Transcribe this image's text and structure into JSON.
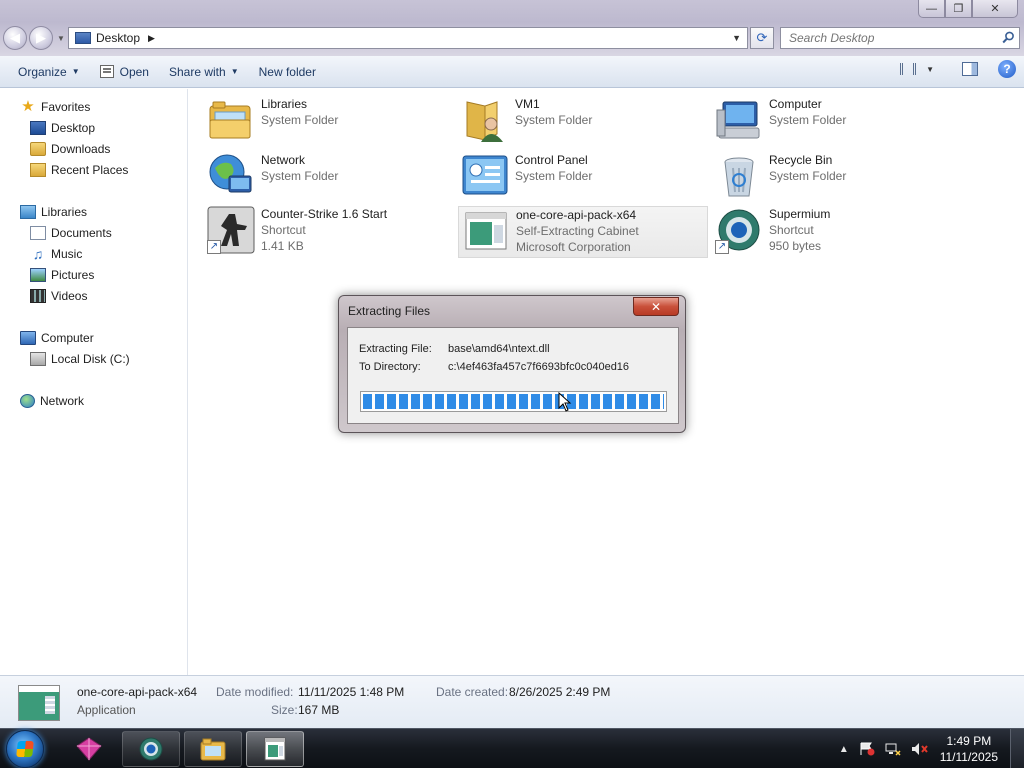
{
  "window": {
    "buttons": {
      "minimize": "—",
      "maximize": "❐",
      "close": "✕"
    }
  },
  "addressbar": {
    "crumb": "Desktop",
    "search_placeholder": "Search Desktop"
  },
  "commandbar": {
    "organize": "Organize",
    "open": "Open",
    "share_with": "Share with",
    "new_folder": "New folder"
  },
  "navpane": {
    "favorites": "Favorites",
    "desktop": "Desktop",
    "downloads": "Downloads",
    "recent_places": "Recent Places",
    "libraries": "Libraries",
    "documents": "Documents",
    "music": "Music",
    "pictures": "Pictures",
    "videos": "Videos",
    "computer": "Computer",
    "local_disk": "Local Disk (C:)",
    "network": "Network"
  },
  "items": [
    {
      "name": "Libraries",
      "line1": "System Folder",
      "line2": "",
      "icon": "libraries-icon"
    },
    {
      "name": "VM1",
      "line1": "System Folder",
      "line2": "",
      "icon": "user-folder-icon"
    },
    {
      "name": "Computer",
      "line1": "System Folder",
      "line2": "",
      "icon": "computer-icon"
    },
    {
      "name": "Network",
      "line1": "System Folder",
      "line2": "",
      "icon": "network-globe-icon"
    },
    {
      "name": "Control Panel",
      "line1": "System Folder",
      "line2": "",
      "icon": "control-panel-icon"
    },
    {
      "name": "Recycle Bin",
      "line1": "System Folder",
      "line2": "",
      "icon": "recycle-bin-icon"
    },
    {
      "name": "Counter-Strike 1.6 Start",
      "line1": "Shortcut",
      "line2": "1.41 KB",
      "icon": "counter-strike-icon"
    },
    {
      "name": "one-core-api-pack-x64",
      "line1": "Self-Extracting Cabinet",
      "line2": "Microsoft Corporation",
      "icon": "cabinet-installer-icon"
    },
    {
      "name": "Supermium",
      "line1": "Shortcut",
      "line2": "950 bytes",
      "icon": "supermium-browser-icon"
    }
  ],
  "dialog": {
    "title": "Extracting Files",
    "close": "✕",
    "file_label": "Extracting File:",
    "file_value": "base\\amd64\\ntext.dll",
    "dir_label": "To Directory:",
    "dir_value": "c:\\4ef463fa457c7f6693bfc0c040ed16",
    "progress": 1.0
  },
  "details": {
    "name": "one-core-api-pack-x64",
    "type": "Application",
    "date_modified_label": "Date modified:",
    "date_modified": "11/11/2025 1:48 PM",
    "date_created_label": "Date created:",
    "date_created": "8/26/2025 2:49 PM",
    "size_label": "Size:",
    "size": "167 MB"
  },
  "taskbar": {
    "time": "1:49 PM",
    "date": "11/11/2025",
    "tray_expand": "▲"
  },
  "colors": {
    "accent": "#2f8be6",
    "taskbar": "#15191f",
    "dialog_close": "#c9503a"
  }
}
